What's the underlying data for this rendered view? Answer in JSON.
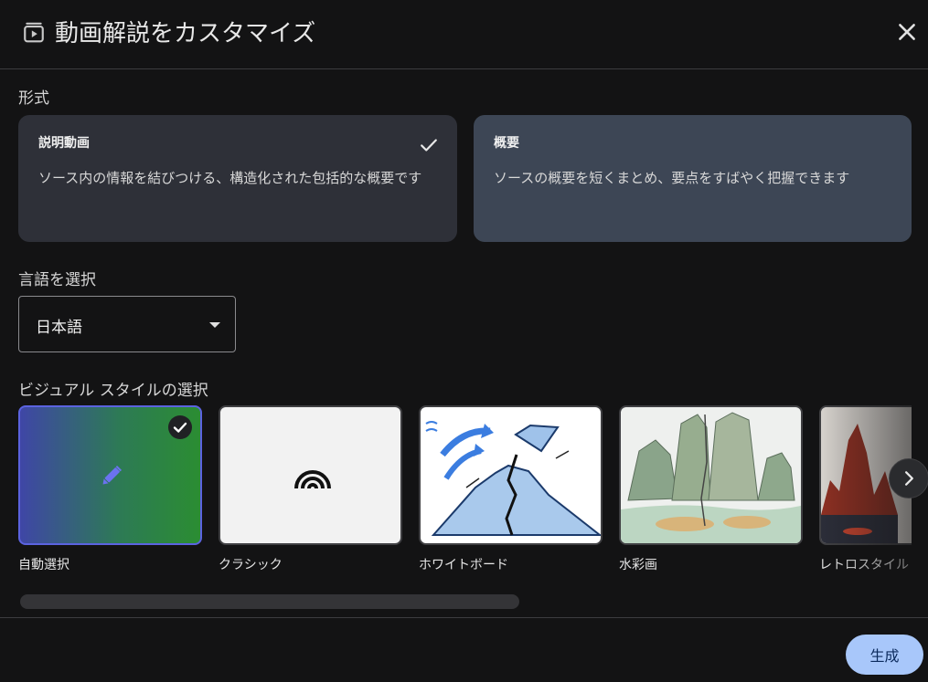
{
  "dialog": {
    "title": "動画解説をカスタマイズ",
    "header_icon": "video-play-icon",
    "close_icon": "close-icon"
  },
  "format": {
    "label": "形式",
    "options": [
      {
        "name": "説明動画",
        "description": "ソース内の情報を結びつける、構造化された包括的な概要です",
        "selected": true
      },
      {
        "name": "概要",
        "description": "ソースの概要を短くまとめ、要点をすばやく把握できます",
        "selected": false
      }
    ]
  },
  "language": {
    "label": "言語を選択",
    "value": "日本語"
  },
  "visual_style": {
    "label": "ビジュアル スタイルの選択",
    "options": [
      {
        "name": "自動選択",
        "selected": true,
        "icon": "pencil-icon"
      },
      {
        "name": "クラシック",
        "selected": false,
        "icon": "arcs-logo-icon"
      },
      {
        "name": "ホワイトボード",
        "selected": false
      },
      {
        "name": "水彩画",
        "selected": false
      },
      {
        "name": "レトロスタイル",
        "selected": false
      }
    ],
    "next_icon": "chevron-right-icon"
  },
  "footer": {
    "generate_label": "生成"
  },
  "colors": {
    "background": "#131314",
    "accent": "#a8c7fa",
    "selected_border": "#5b63e0"
  }
}
